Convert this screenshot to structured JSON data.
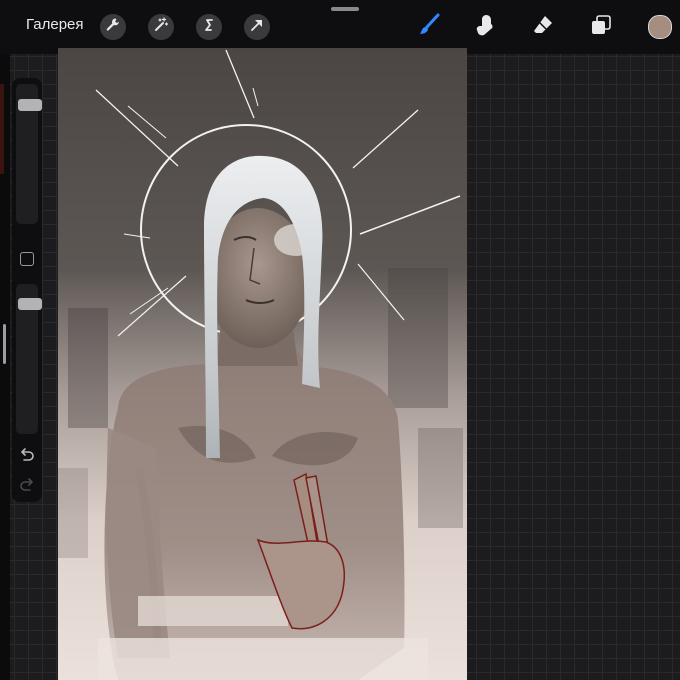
{
  "toolbar": {
    "gallery_label": "Галерея",
    "left_tools": [
      {
        "name": "wrench-icon"
      },
      {
        "name": "magic-wand-icon"
      },
      {
        "name": "selection-icon"
      },
      {
        "name": "transform-arrow-icon"
      }
    ],
    "right_tools": [
      {
        "name": "brush-icon",
        "active": true,
        "color": "#2e8bff"
      },
      {
        "name": "smudge-icon"
      },
      {
        "name": "eraser-icon"
      },
      {
        "name": "layers-icon"
      }
    ],
    "current_color": "#a58d80"
  },
  "sidebar": {
    "brush_size": 0.88,
    "opacity": 0.9
  },
  "canvas": {
    "background": "#e6dad4",
    "sky_color": "#58524f"
  }
}
